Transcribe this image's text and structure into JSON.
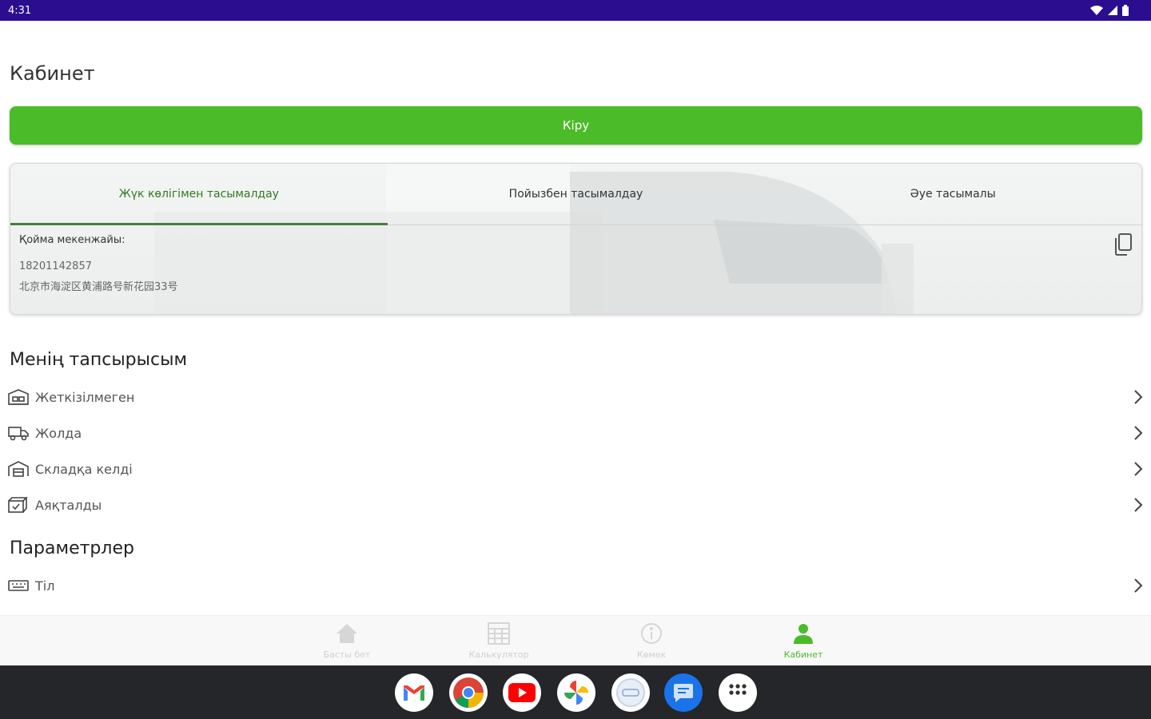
{
  "status_bar": {
    "time": "4:31"
  },
  "page": {
    "title": "Кабинет"
  },
  "login": {
    "label": "Кіру"
  },
  "warehouse_card": {
    "tabs": [
      {
        "label": "Жүк көлігімен тасымалдау",
        "active": true
      },
      {
        "label": "Пойызбен тасымалдау",
        "active": false
      },
      {
        "label": "Әуе тасымалы",
        "active": false
      }
    ],
    "address_label": "Қойма мекенжайы:",
    "phone": "18201142857",
    "address": "北京市海淀区黄浦路号新花园33号"
  },
  "orders": {
    "title": "Менің тапсырысым",
    "items": [
      {
        "label": "Жеткізілмеген",
        "icon": "warehouse-icon"
      },
      {
        "label": "Жолда",
        "icon": "truck-icon"
      },
      {
        "label": "Складқа келді",
        "icon": "storage-icon"
      },
      {
        "label": "Аяқталды",
        "icon": "box-check-icon"
      }
    ]
  },
  "settings": {
    "title": "Параметрлер",
    "items": [
      {
        "label": "Тіл",
        "icon": "keyboard-icon"
      }
    ]
  },
  "bottom_nav": {
    "items": [
      {
        "label": "Басты бет",
        "icon": "home-icon",
        "active": false
      },
      {
        "label": "Калькулятор",
        "icon": "calculator-icon",
        "active": false
      },
      {
        "label": "Көмек",
        "icon": "info-icon",
        "active": false
      },
      {
        "label": "Кабинет",
        "icon": "person-icon",
        "active": true
      }
    ]
  },
  "dock": {
    "apps": [
      "gmail-icon",
      "chrome-icon",
      "youtube-icon",
      "photos-icon",
      "camera-icon",
      "messages-icon",
      "app-drawer-icon"
    ]
  },
  "colors": {
    "accent": "#4cbb29",
    "status_bar": "#2a0e8f",
    "active_tab_text": "#2e7d1e",
    "taskbar": "#242629"
  }
}
